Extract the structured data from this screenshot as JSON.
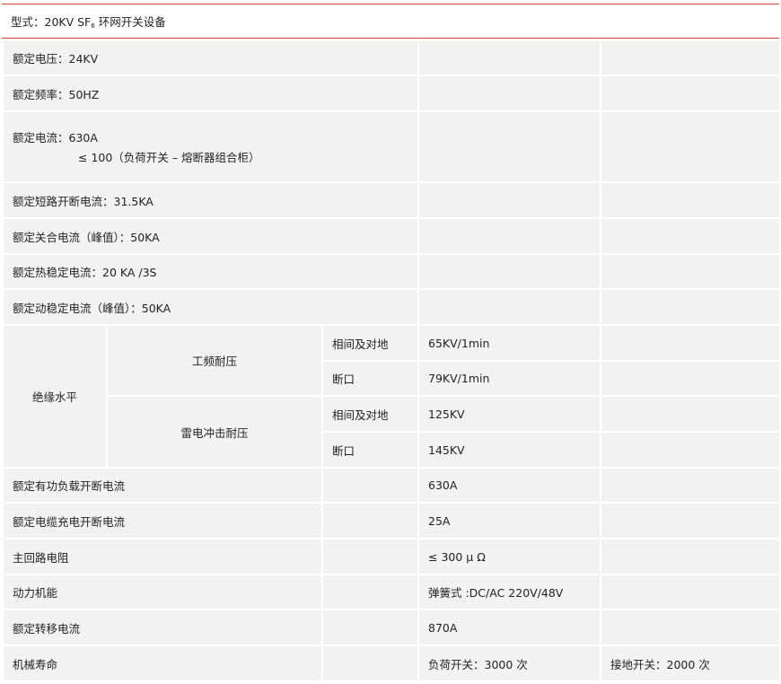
{
  "header": {
    "label": "型式：20KV SF",
    "sub": "6",
    "rest": " 环网开关设备"
  },
  "rows": {
    "voltage": "额定电压：24KV",
    "frequency": "额定频率：50HZ",
    "current_line1": "额定电流：630A",
    "current_line2": "≤ 100（负荷开关 – 熔断器组合柜）",
    "short_break": "额定短路开断电流：31.5KA",
    "making_peak": "额定关合电流（峰值）：50KA",
    "thermal": "额定热稳定电流：20 KA /3S",
    "dynamic_peak": "额定动稳定电流（峰值）：50KA"
  },
  "insulation": {
    "label": "绝缘水平",
    "power_freq": {
      "label": "工频耐压",
      "phase_ground_label": "相间及对地",
      "phase_ground_value": "65KV/1min",
      "break_label": "断口",
      "break_value": "79KV/1min"
    },
    "lightning": {
      "label": "雷电冲击耐压",
      "phase_ground_label": "相间及对地",
      "phase_ground_value": "125KV",
      "break_label": "断口",
      "break_value": "145KV"
    }
  },
  "bottom": [
    {
      "label": "额定有功负载开断电流",
      "value": "630A",
      "extra": ""
    },
    {
      "label": "额定电缆充电开断电流",
      "value": "25A",
      "extra": ""
    },
    {
      "label": "主回路电阻",
      "value": "≤ 300 μ Ω",
      "extra": ""
    },
    {
      "label": "动力机能",
      "value": "弹簧式 :DC/AC 220V/48V",
      "extra": ""
    },
    {
      "label": "额定转移电流",
      "value": "870A",
      "extra": ""
    },
    {
      "label": "机械寿命",
      "value": "负荷开关：3000 次",
      "extra": "接地开关：2000 次"
    }
  ],
  "colors": {
    "accent": "#d9442c",
    "cell_bg": "#f2f2f2"
  }
}
